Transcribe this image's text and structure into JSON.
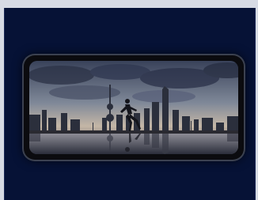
{
  "panel": {
    "background": "#061236"
  },
  "phone": {
    "frame_color": "#0b0b0f",
    "wallpaper": "city-skyline-runner-photo"
  }
}
